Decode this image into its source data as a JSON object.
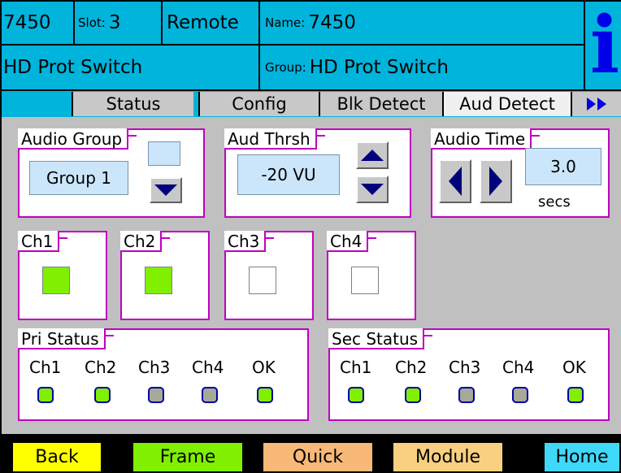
{
  "header": {
    "model": "7450",
    "slot_label": "Slot:",
    "slot_value": "3",
    "mode": "Remote",
    "name_label": "Name:",
    "name_value": "7450",
    "card_type": "HD Prot Switch",
    "group_label": "Group:",
    "group_value": "HD Prot Switch",
    "info_glyph": "i",
    "info_icon": "info-icon",
    "colors": {
      "bg": "#00b4dc",
      "info": "#0000e8"
    }
  },
  "tabs": [
    {
      "label": "Status",
      "active": false
    },
    {
      "label": "Config",
      "active": false
    },
    {
      "label": "Blk Detect",
      "active": false
    },
    {
      "label": "Aud Detect",
      "active": true
    }
  ],
  "tabs_more_icon": "double-right-arrow-icon",
  "audio_group": {
    "title": "Audio Group",
    "value": "Group 1",
    "up_value": "",
    "down_icon": "down-arrow-icon"
  },
  "aud_thrsh": {
    "title": "Aud Thrsh",
    "value": "-20 VU",
    "up_icon": "up-arrow-icon",
    "down_icon": "down-arrow-icon"
  },
  "audio_time": {
    "title": "Audio Time",
    "value": "3.0",
    "unit": "secs",
    "left_icon": "left-arrow-icon",
    "right_icon": "right-arrow-icon"
  },
  "channels": [
    {
      "label": "Ch1",
      "active": true
    },
    {
      "label": "Ch2",
      "active": true
    },
    {
      "label": "Ch3",
      "active": false
    },
    {
      "label": "Ch4",
      "active": false
    }
  ],
  "pri_status": {
    "title": "Pri Status",
    "items": [
      {
        "label": "Ch1",
        "state": "ok"
      },
      {
        "label": "Ch2",
        "state": "ok"
      },
      {
        "label": "Ch3",
        "state": "off"
      },
      {
        "label": "Ch4",
        "state": "off"
      },
      {
        "label": "OK",
        "state": "ok"
      }
    ]
  },
  "sec_status": {
    "title": "Sec Status",
    "items": [
      {
        "label": "Ch1",
        "state": "ok"
      },
      {
        "label": "Ch2",
        "state": "ok"
      },
      {
        "label": "Ch3",
        "state": "off"
      },
      {
        "label": "Ch4",
        "state": "off"
      },
      {
        "label": "OK",
        "state": "ok"
      }
    ]
  },
  "colors": {
    "green": "#80f000",
    "gray_led": "#a8a898",
    "box_border": "#c000c0",
    "panel_bg": "#c0c0c0"
  },
  "nav": [
    {
      "label": "Back",
      "color": "#ffff00"
    },
    {
      "label": "Frame",
      "color": "#80f000"
    },
    {
      "label": "Quick",
      "color": "#f8b878"
    },
    {
      "label": "Module",
      "color": "#f8d080"
    },
    {
      "label": "Home",
      "color": "#40d8f8"
    }
  ]
}
